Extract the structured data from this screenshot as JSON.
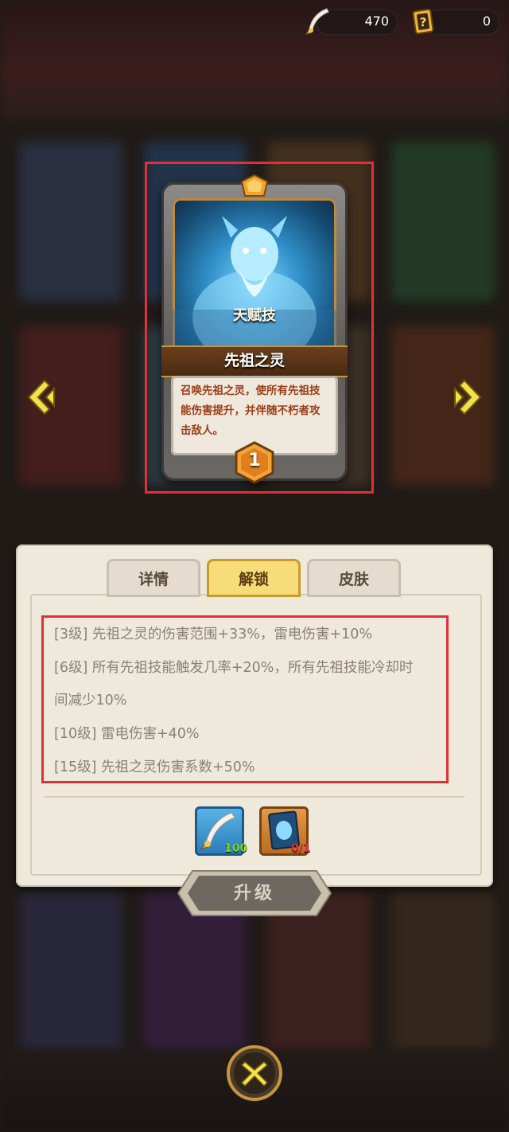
{
  "currency": {
    "feathers": "470",
    "cards": "0"
  },
  "card": {
    "type_label": "天赋技",
    "name": "先祖之灵",
    "description": "召唤先祖之灵，使所有先祖技能伤害提升，并伴随不朽者攻击敌人。",
    "level": "1"
  },
  "tabs": [
    {
      "label": "详情",
      "active": false
    },
    {
      "label": "解锁",
      "active": true
    },
    {
      "label": "皮肤",
      "active": false
    }
  ],
  "unlocks": [
    "[3级]  先祖之灵的伤害范围+33%，雷电伤害+10%",
    "[6级]  所有先祖技能触发几率+20%，所有先祖技能冷却时",
    "间减少10%",
    "[10级]  雷电伤害+40%",
    "[15级]  先祖之灵伤害系数+50%"
  ],
  "costs": [
    {
      "icon": "feather-icon",
      "count": "100",
      "color": "#7ed321"
    },
    {
      "icon": "card-icon",
      "count": "0/1",
      "color": "#e0303a"
    }
  ],
  "upgrade_label": "升级"
}
